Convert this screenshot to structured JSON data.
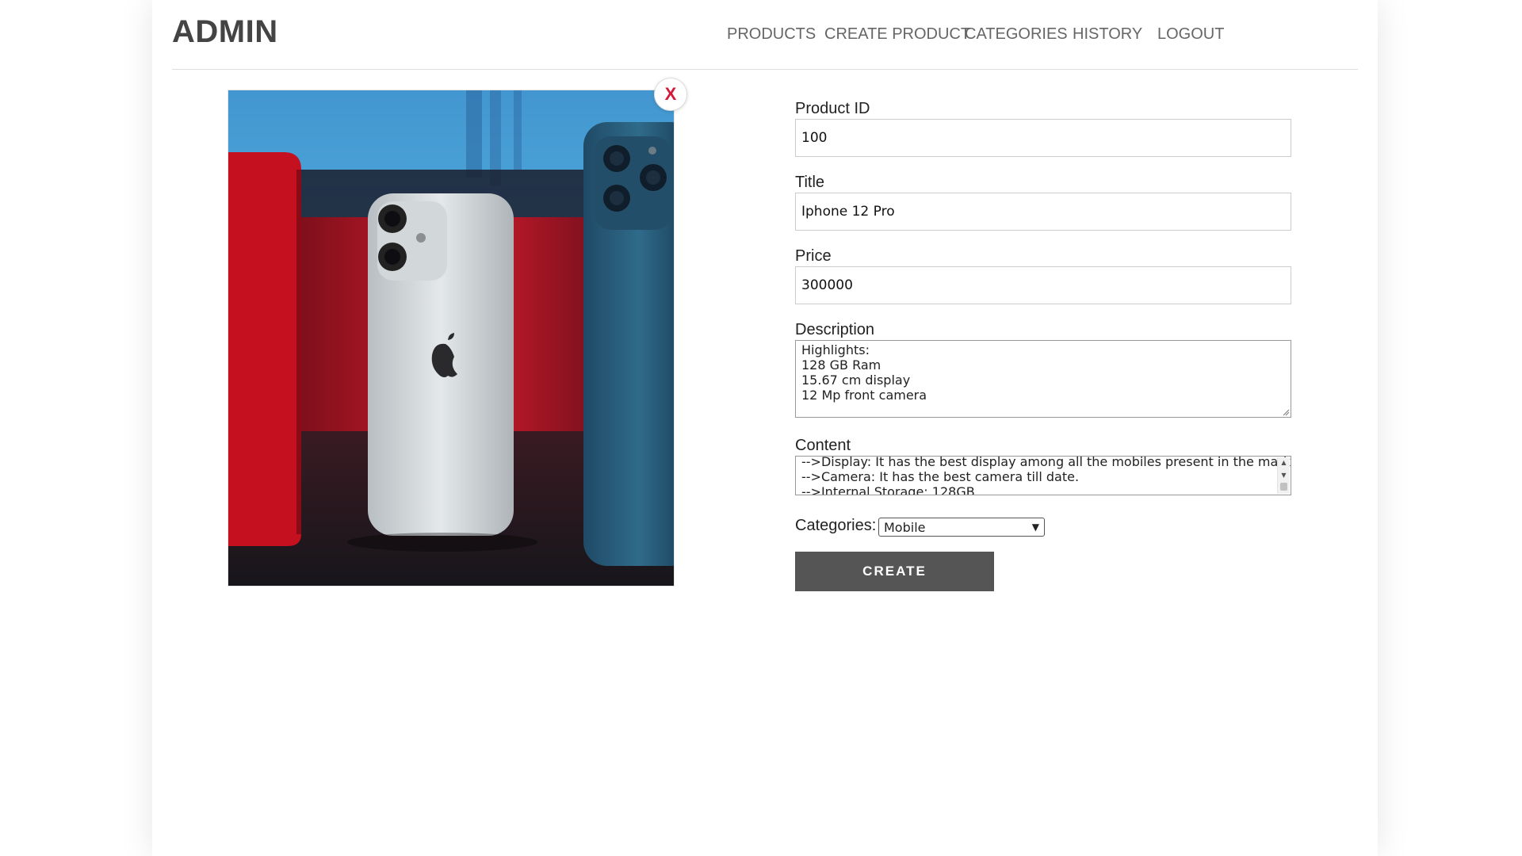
{
  "header": {
    "brand": "ADMIN",
    "nav": [
      {
        "label": "PRODUCTS"
      },
      {
        "label": "CREATE PRODUCT"
      },
      {
        "label": "CATEGORIES"
      },
      {
        "label": "HISTORY"
      },
      {
        "label": "LOGOUT"
      }
    ]
  },
  "image": {
    "remove_label": "X"
  },
  "form": {
    "product_id": {
      "label": "Product ID",
      "value": "100"
    },
    "title": {
      "label": "Title",
      "value": "Iphone 12 Pro"
    },
    "price": {
      "label": "Price",
      "value": "300000"
    },
    "description": {
      "label": "Description",
      "lines": [
        "Highlights:",
        "128 GB Ram",
        "15.67 cm display",
        "12 Mp front camera"
      ]
    },
    "content": {
      "label": "Content",
      "lines": [
        "-->Display: It has the best display among all the mobiles present in the market.",
        "-->Camera: It has the best camera till date.",
        "-->Internal Storage: 128GB"
      ]
    },
    "categories": {
      "label": "Categories:",
      "selected": "Mobile"
    },
    "submit_label": "CREATE"
  },
  "colors": {
    "accent_remove": "#d4183a",
    "button_bg": "#555555",
    "brand_text": "#444444"
  }
}
